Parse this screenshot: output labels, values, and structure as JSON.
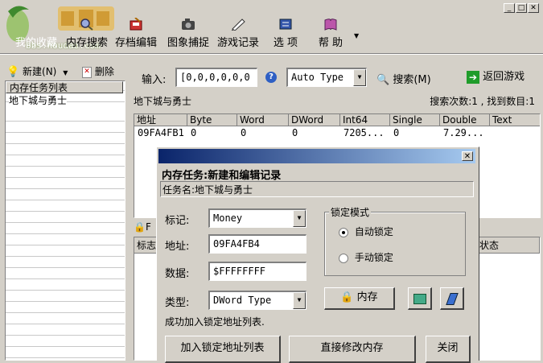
{
  "window": {
    "minimize": "_",
    "maximize": "□",
    "close": "✕"
  },
  "watermark": {
    "brand": "bbs.houdao.com"
  },
  "toolbar": [
    {
      "label": "我的收藏",
      "icon": "star-icon"
    },
    {
      "label": "内存搜索",
      "icon": "magnifier-icon"
    },
    {
      "label": "存档编辑",
      "icon": "disk-edit-icon"
    },
    {
      "label": "图象捕捉",
      "icon": "camera-icon"
    },
    {
      "label": "游戏记录",
      "icon": "pen-icon"
    },
    {
      "label": "选 项",
      "icon": "options-icon"
    },
    {
      "label": "帮 助",
      "icon": "help-book-icon"
    }
  ],
  "sidebar": {
    "new_label": "新建(N)",
    "delete_label": "删除",
    "list_header": "内存任务列表",
    "items": [
      "地下城与勇士"
    ]
  },
  "search": {
    "input_label": "输入:",
    "input_value": "[0,0,0,0,0,0",
    "type_value": "Auto Type",
    "search_label": "搜索(M)",
    "return_label": "返回游戏",
    "task_name": "地下城与勇士",
    "stats": "搜索次数:1 , 找到数目:1"
  },
  "results": {
    "columns": [
      "地址",
      "Byte",
      "Word",
      "DWord",
      "Int64",
      "Single",
      "Double",
      "Text"
    ],
    "rows": [
      [
        "09FA4FB1",
        "0",
        "0",
        "0",
        "7205...",
        "0",
        "7.29...",
        ""
      ]
    ]
  },
  "lower_panel": {
    "col_left": "标志",
    "col_right": "状态",
    "tab_initial": "F"
  },
  "dialog": {
    "title": "内存任务:新建和编辑记录",
    "task_name": "任务名:地下城与勇士",
    "mark_label": "标记:",
    "mark_value": "Money",
    "address_label": "地址:",
    "address_value": "09FA4FB4",
    "data_label": "数据:",
    "data_value": "$FFFFFFFF",
    "type_label": "类型:",
    "type_value": "DWord Type",
    "lock_group_title": "锁定模式",
    "radio_auto": "自动锁定",
    "radio_manual": "手动锁定",
    "memory_button": "内存",
    "status_message": "成功加入锁定地址列表.",
    "add_lock_button": "加入锁定地址列表",
    "modify_button": "直接修改内存",
    "close_button": "关闭"
  }
}
